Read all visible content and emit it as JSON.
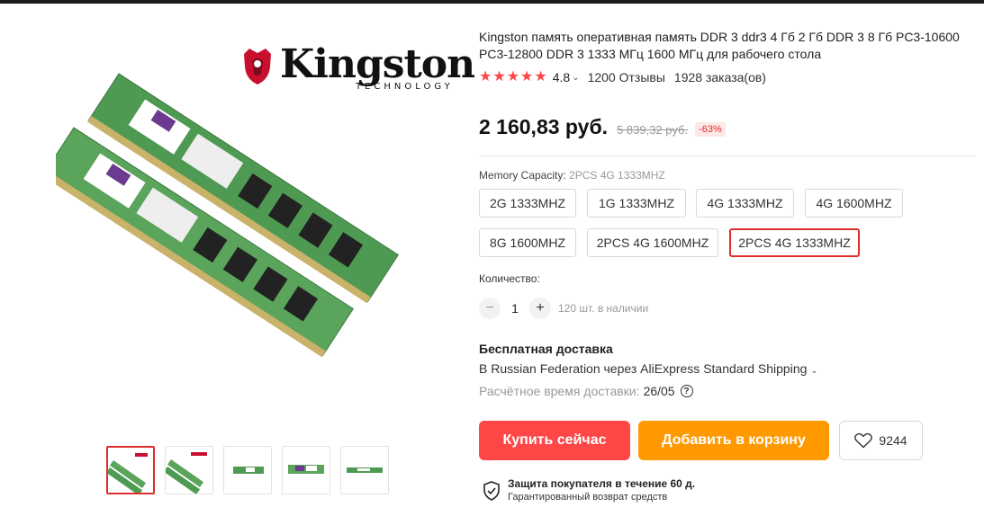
{
  "product": {
    "title": "Kingston память оперативная память DDR 3 ddr3 4 Гб 2 Гб DDR 3 8 Гб PC3-10600 PC3-12800 DDR 3 1333 МГц 1600 МГц для рабочего стола",
    "brand_logo_text": "Kingston",
    "brand_logo_sub": "TECHNOLOGY"
  },
  "rating": {
    "stars": 5,
    "value": "4.8",
    "reviews": "1200 Отзывы",
    "orders": "1928 заказа(ов)"
  },
  "price": {
    "current": "2 160,83 руб.",
    "old": "5 839,32 руб.",
    "discount": "-63%"
  },
  "memory": {
    "label": "Memory Capacity: ",
    "selected": "2PCS 4G 1333MHZ",
    "options": [
      "2G 1333MHZ",
      "1G 1333MHZ",
      "4G 1333MHZ",
      "4G 1600MHZ",
      "8G 1600MHZ",
      "2PCS 4G 1600MHZ",
      "2PCS 4G 1333MHZ"
    ],
    "selected_index": 6
  },
  "quantity": {
    "label": "Количество:",
    "minus": "−",
    "value": "1",
    "plus": "+",
    "stock": "120 шт. в наличии"
  },
  "shipping": {
    "title": "Бесплатная доставка",
    "line": "В Russian Federation через AliExpress Standard Shipping",
    "time_label": "Расчётное время доставки:",
    "time_value": "26/05",
    "help": "?"
  },
  "actions": {
    "buy": "Купить сейчас",
    "cart": "Добавить в корзину",
    "wish_count": "9244"
  },
  "protection": {
    "title": "Защита покупателя в течение 60 д.",
    "subtitle": "Гарантированный возврат средств"
  },
  "colors": {
    "accent_red": "#ff4747",
    "accent_orange": "#ff9900",
    "selected_border": "#e02d2d"
  },
  "gallery": {
    "active_index": 0
  }
}
